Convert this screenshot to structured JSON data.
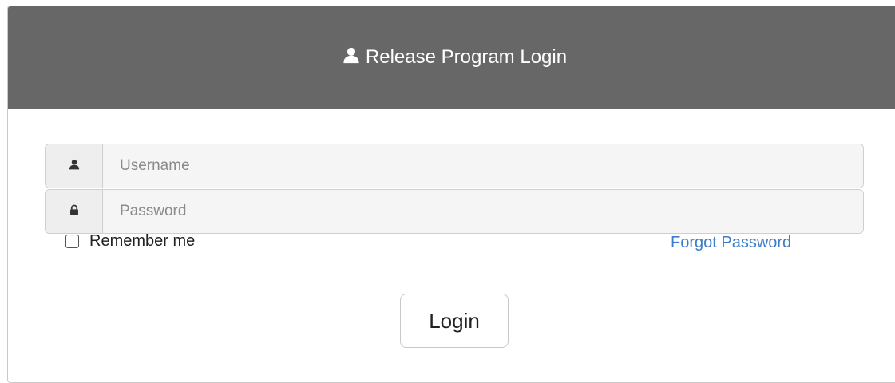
{
  "header": {
    "title": "Release Program Login",
    "icon": "user-icon",
    "background": "#686767"
  },
  "form": {
    "username": {
      "icon": "user-icon",
      "placeholder": "Username",
      "value": ""
    },
    "password": {
      "icon": "lock-icon",
      "placeholder": "Password",
      "value": ""
    },
    "remember_label": "Remember me",
    "remember_checked": false,
    "forgot_label": "Forgot Password",
    "login_label": "Login"
  },
  "colors": {
    "link": "#3d7cc9",
    "header_bg": "#686767"
  }
}
